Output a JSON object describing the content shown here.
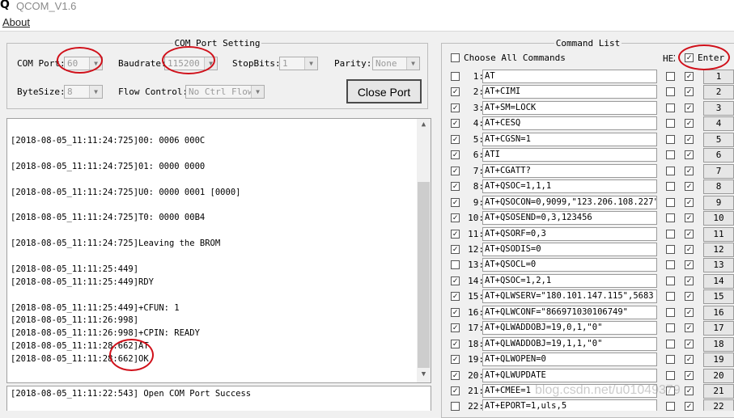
{
  "window": {
    "logo": "Q",
    "title": "QCOM_V1.6"
  },
  "menu": {
    "about": "About"
  },
  "com_port_setting": {
    "title": "COM Port Setting",
    "com_port_label": "COM Port:",
    "com_port_value": "60",
    "baudrate_label": "Baudrate:",
    "baudrate_value": "115200",
    "stopbits_label": "StopBits:",
    "stopbits_value": "1",
    "parity_label": "Parity:",
    "parity_value": "None",
    "bytesize_label": "ByteSize:",
    "bytesize_value": "8",
    "flow_label": "Flow Control:",
    "flow_value": "No Ctrl Flow",
    "close_port_label": "Close Port"
  },
  "log": {
    "lines": [
      "[2018-08-05_11:11:24:725]00: 0006 000C",
      "",
      "[2018-08-05_11:11:24:725]01: 0000 0000",
      "",
      "[2018-08-05_11:11:24:725]U0: 0000 0001 [0000]",
      "",
      "[2018-08-05_11:11:24:725]T0: 0000 00B4",
      "",
      "[2018-08-05_11:11:24:725]Leaving the BROM",
      "",
      "[2018-08-05_11:11:25:449]",
      "[2018-08-05_11:11:25:449]RDY",
      "",
      "[2018-08-05_11:11:25:449]+CFUN: 1",
      "[2018-08-05_11:11:26:998]",
      "[2018-08-05_11:11:26:998]+CPIN: READY",
      "[2018-08-05_11:11:28:662]AT",
      "[2018-08-05_11:11:28:662]OK"
    ]
  },
  "status": {
    "text": "[2018-08-05_11:11:22:543] Open COM Port Success"
  },
  "command_list": {
    "title": "Command List",
    "choose_all_label": "Choose All Commands",
    "hex_label": "HEX",
    "enter_label": "Enter",
    "commands": [
      {
        "num": "1:",
        "text": "AT",
        "checked": false,
        "hex": false,
        "enter": true,
        "btn": "1"
      },
      {
        "num": "2:",
        "text": "AT+CIMI",
        "checked": true,
        "hex": false,
        "enter": true,
        "btn": "2"
      },
      {
        "num": "3:",
        "text": "AT+SM=LOCK",
        "checked": true,
        "hex": false,
        "enter": true,
        "btn": "3"
      },
      {
        "num": "4:",
        "text": "AT+CESQ",
        "checked": true,
        "hex": false,
        "enter": true,
        "btn": "4"
      },
      {
        "num": "5:",
        "text": "AT+CGSN=1",
        "checked": true,
        "hex": false,
        "enter": true,
        "btn": "5"
      },
      {
        "num": "6:",
        "text": "ATI",
        "checked": true,
        "hex": false,
        "enter": true,
        "btn": "6"
      },
      {
        "num": "7:",
        "text": "AT+CGATT?",
        "checked": true,
        "hex": false,
        "enter": true,
        "btn": "7"
      },
      {
        "num": "8:",
        "text": "AT+QSOC=1,1,1",
        "checked": true,
        "hex": false,
        "enter": true,
        "btn": "8"
      },
      {
        "num": "9:",
        "text": "AT+QSOCON=0,9099,\"123.206.108.227\"",
        "checked": true,
        "hex": false,
        "enter": true,
        "btn": "9"
      },
      {
        "num": "10:",
        "text": "AT+QSOSEND=0,3,123456",
        "checked": true,
        "hex": false,
        "enter": true,
        "btn": "10"
      },
      {
        "num": "11:",
        "text": "AT+QSORF=0,3",
        "checked": true,
        "hex": false,
        "enter": true,
        "btn": "11"
      },
      {
        "num": "12:",
        "text": "AT+QSODIS=0",
        "checked": true,
        "hex": false,
        "enter": true,
        "btn": "12"
      },
      {
        "num": "13:",
        "text": "AT+QSOCL=0",
        "checked": false,
        "hex": false,
        "enter": true,
        "btn": "13"
      },
      {
        "num": "14:",
        "text": "AT+QSOC=1,2,1",
        "checked": true,
        "hex": false,
        "enter": true,
        "btn": "14"
      },
      {
        "num": "15:",
        "text": "AT+QLWSERV=\"180.101.147.115\",5683",
        "checked": true,
        "hex": false,
        "enter": true,
        "btn": "15"
      },
      {
        "num": "16:",
        "text": "AT+QLWCONF=\"866971030106749\"",
        "checked": true,
        "hex": false,
        "enter": true,
        "btn": "16"
      },
      {
        "num": "17:",
        "text": "AT+QLWADDOBJ=19,0,1,\"0\"",
        "checked": true,
        "hex": false,
        "enter": true,
        "btn": "17"
      },
      {
        "num": "18:",
        "text": "AT+QLWADDOBJ=19,1,1,\"0\"",
        "checked": true,
        "hex": false,
        "enter": true,
        "btn": "18"
      },
      {
        "num": "19:",
        "text": "AT+QLWOPEN=0",
        "checked": true,
        "hex": false,
        "enter": true,
        "btn": "19"
      },
      {
        "num": "20:",
        "text": "AT+QLWUPDATE",
        "checked": true,
        "hex": false,
        "enter": true,
        "btn": "20"
      },
      {
        "num": "21:",
        "text": "AT+CMEE=1",
        "checked": true,
        "hex": false,
        "enter": true,
        "btn": "21"
      },
      {
        "num": "22:",
        "text": "AT+EPORT=1,uls,5",
        "checked": false,
        "hex": false,
        "enter": true,
        "btn": "22"
      }
    ]
  },
  "watermark": "blog.csdn.net/u01049379",
  "colors": {
    "annotation_red": "#d0101a"
  }
}
